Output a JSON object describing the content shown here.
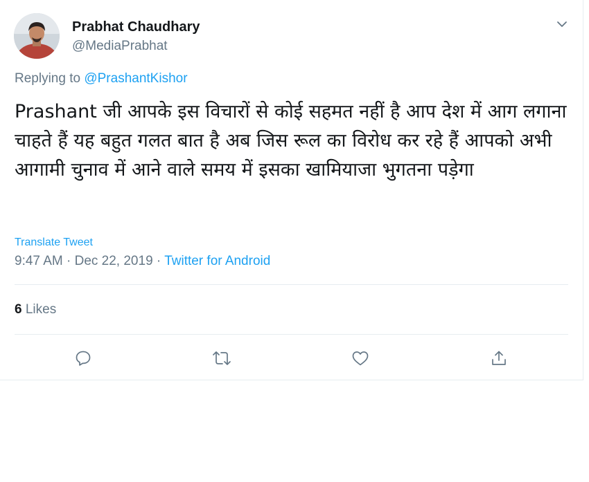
{
  "user": {
    "name": "Prabhat Chaudhary",
    "handle": "@MediaPrabhat"
  },
  "reply": {
    "prefix": "Replying to",
    "mention": "@PrashantKishor"
  },
  "tweet": {
    "text": "Prashant जी आपके इस विचारों से कोई सहमत नहीं है आप देश में आग लगाना चाहते हैं यह बहुत गलत बात है अब जिस रूल का विरोध कर रहे हैं आपको अभी आगामी चुनाव में आने वाले समय में इसका खामियाजा भुगतना पड़ेगा",
    "translate_label": "Translate Tweet",
    "time": "9:47 AM",
    "date": "Dec 22, 2019",
    "separator": "·",
    "source": "Twitter for Android"
  },
  "stats": {
    "likes_count": "6",
    "likes_label": "Likes"
  },
  "actions": {
    "icons": [
      "reply-icon",
      "retweet-icon",
      "like-icon",
      "share-icon"
    ]
  },
  "colors": {
    "accent": "#1da1f2",
    "secondary_text": "#657786",
    "icon": "#657786",
    "divider": "#e6ecf0"
  }
}
